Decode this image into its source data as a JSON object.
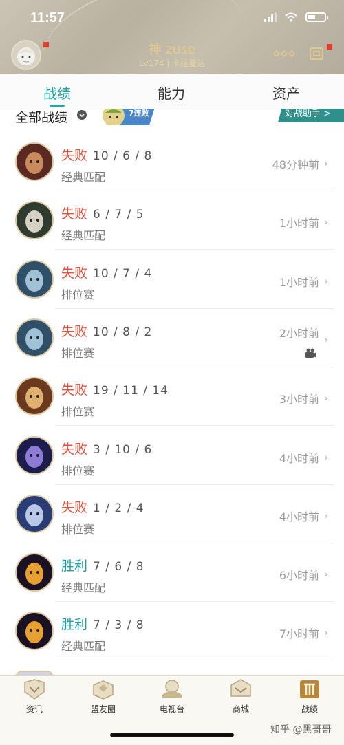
{
  "status_bar": {
    "time": "11:57"
  },
  "profile": {
    "name": "神 zuse",
    "level_server": "Lv174 | 卡拉曼达"
  },
  "tabs": [
    {
      "label": "战绩",
      "active": true
    },
    {
      "label": "能力",
      "active": false
    },
    {
      "label": "资产",
      "active": false
    }
  ],
  "filter": {
    "label": "全部战绩",
    "badge_text": "7连败",
    "assistant_button": "对战助手 >"
  },
  "matches": [
    {
      "result": "失败",
      "kda": "10 / 6 / 8",
      "mode": "经典匹配",
      "time_ago": "48分钟前",
      "outcome": "loss",
      "has_video": false
    },
    {
      "result": "失败",
      "kda": "6 / 7 / 5",
      "mode": "经典匹配",
      "time_ago": "1小时前",
      "outcome": "loss",
      "has_video": false
    },
    {
      "result": "失败",
      "kda": "10 / 7 / 4",
      "mode": "排位赛",
      "time_ago": "1小时前",
      "outcome": "loss",
      "has_video": false
    },
    {
      "result": "失败",
      "kda": "10 / 8 / 2",
      "mode": "排位赛",
      "time_ago": "2小时前",
      "outcome": "loss",
      "has_video": true
    },
    {
      "result": "失败",
      "kda": "19 / 11 / 14",
      "mode": "排位赛",
      "time_ago": "3小时前",
      "outcome": "loss",
      "has_video": false
    },
    {
      "result": "失败",
      "kda": "3 / 10 / 6",
      "mode": "排位赛",
      "time_ago": "4小时前",
      "outcome": "loss",
      "has_video": false
    },
    {
      "result": "失败",
      "kda": "1 / 2 / 4",
      "mode": "排位赛",
      "time_ago": "4小时前",
      "outcome": "loss",
      "has_video": false
    },
    {
      "result": "胜利",
      "kda": "7 / 6 / 8",
      "mode": "经典匹配",
      "time_ago": "6小时前",
      "outcome": "win",
      "has_video": false
    },
    {
      "result": "胜利",
      "kda": "7 / 3 / 8",
      "mode": "经典匹配",
      "time_ago": "7小时前",
      "outcome": "win",
      "has_video": false
    }
  ],
  "bottom_nav": [
    {
      "label": "资讯",
      "icon": "news-icon",
      "active": false
    },
    {
      "label": "盟友圈",
      "icon": "friends-circle-icon",
      "active": false
    },
    {
      "label": "电视台",
      "icon": "tv-icon",
      "active": false
    },
    {
      "label": "商城",
      "icon": "shop-icon",
      "active": false
    },
    {
      "label": "战绩",
      "icon": "record-icon",
      "active": true
    }
  ],
  "watermark": "知乎 @黑哥哥",
  "colors": {
    "accent": "#1fa9a6",
    "loss": "#e0503d",
    "win": "#1aa1a0",
    "gold": "#e4cb8f",
    "assistant_bg": "#2f8f8a"
  }
}
